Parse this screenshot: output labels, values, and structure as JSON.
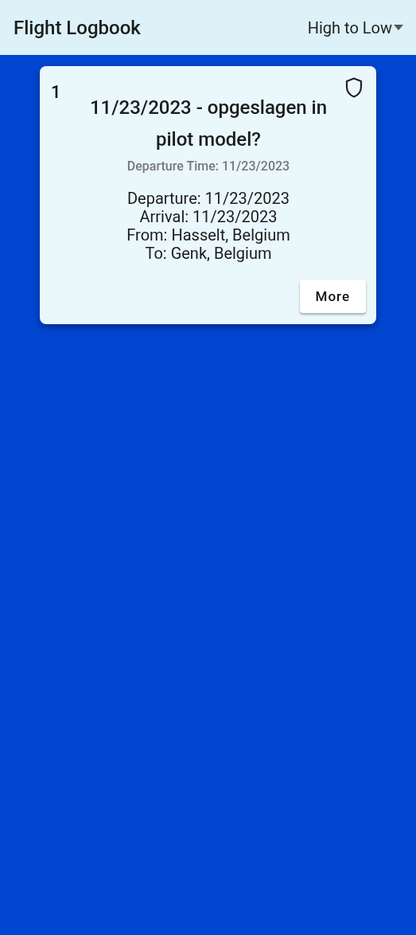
{
  "header": {
    "title": "Flight Logbook",
    "sort": {
      "label": "High to Low"
    }
  },
  "flights": [
    {
      "number": "1",
      "title": "11/23/2023 - opgeslagen in pilot model?",
      "subtitle": "Departure Time: 11/23/2023",
      "details": [
        "Departure: 11/23/2023",
        "Arrival: 11/23/2023",
        "From: Hasselt, Belgium",
        "To: Genk, Belgium"
      ],
      "button": "More"
    }
  ]
}
